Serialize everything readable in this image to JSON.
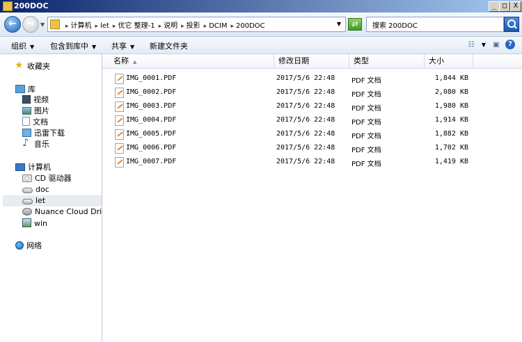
{
  "window": {
    "title": "200DOC",
    "buttons": {
      "minimize": "_",
      "maximize": "□",
      "close": "X"
    }
  },
  "address": {
    "crumbs": [
      "计算机",
      "let",
      "优它 整理-1",
      "说明",
      "投影",
      "DCIM",
      "200DOC"
    ],
    "separator": "▸"
  },
  "search": {
    "placeholder": "搜索 200DOC"
  },
  "toolbar": {
    "organize": "组织",
    "include_in_library": "包含到库中",
    "share": "共享",
    "new_folder": "新建文件夹",
    "dropdown_arrow": "▼"
  },
  "nav": {
    "favorites": "收藏夹",
    "library": "库",
    "library_items": [
      "视频",
      "图片",
      "文档",
      "迅雷下载",
      "音乐"
    ],
    "computer": "计算机",
    "computer_items": [
      "CD 驱动器",
      "doc",
      "let",
      "Nuance Cloud Drive",
      "win"
    ],
    "selected": "let",
    "network": "网络"
  },
  "columns": {
    "name": "名称",
    "date": "修改日期",
    "type": "类型",
    "size": "大小"
  },
  "files": [
    {
      "name": "IMG_0001.PDF",
      "date": "2017/5/6 22:48",
      "type": "PDF 文档",
      "size": "1,844 KB"
    },
    {
      "name": "IMG_0002.PDF",
      "date": "2017/5/6 22:48",
      "type": "PDF 文档",
      "size": "2,080 KB"
    },
    {
      "name": "IMG_0003.PDF",
      "date": "2017/5/6 22:48",
      "type": "PDF 文档",
      "size": "1,980 KB"
    },
    {
      "name": "IMG_0004.PDF",
      "date": "2017/5/6 22:48",
      "type": "PDF 文档",
      "size": "1,914 KB"
    },
    {
      "name": "IMG_0005.PDF",
      "date": "2017/5/6 22:48",
      "type": "PDF 文档",
      "size": "1,882 KB"
    },
    {
      "name": "IMG_0006.PDF",
      "date": "2017/5/6 22:48",
      "type": "PDF 文档",
      "size": "1,702 KB"
    },
    {
      "name": "IMG_0007.PDF",
      "date": "2017/5/6 22:48",
      "type": "PDF 文档",
      "size": "1,419 KB"
    }
  ],
  "colors": {
    "title_bar": "#0a246a",
    "selection": "#e8ebef",
    "accent": "#2a66c8"
  }
}
